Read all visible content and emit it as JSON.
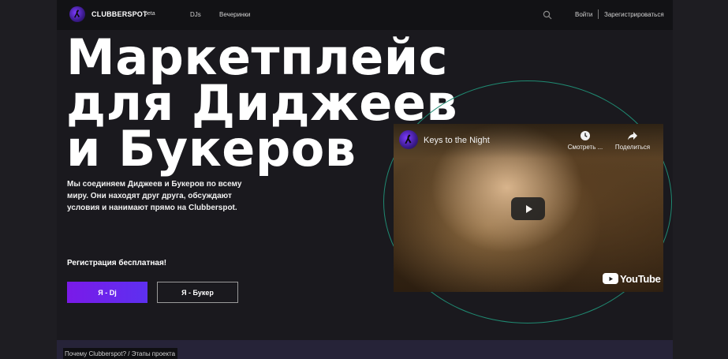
{
  "brand": {
    "name": "CLUBBERSPOT",
    "tag": "beta",
    "logo_icon": "dj-silhouette-icon",
    "logo_color": "#5d2ccf"
  },
  "nav": {
    "djs": "DJs",
    "parties": "Вечеринки",
    "search_icon": "search-icon",
    "login": "Войти",
    "register": "Зарегистрироваться"
  },
  "hero": {
    "title_lines": [
      "Маркетплейс",
      "для Диджеев",
      "и Букеров"
    ],
    "description": "Мы соединяем Диджеев и Букеров по всему миру. Они находят друг друга, обсуждают условия и нанимают прямо на Clubberspot.",
    "free_note": "Регистрация бесплатная!",
    "btn_dj": "Я - Dj",
    "btn_booker": "Я - Букер",
    "accent": "#7a1ae8",
    "ring_color": "#1f8a72"
  },
  "video": {
    "title": "Keys to the Night",
    "watch_later": "Смотреть ...",
    "share": "Поделиться",
    "provider": "YouTube",
    "play_icon": "play-icon"
  },
  "bottom": {
    "tab_label": "Почему Clubberspot? / Этапы проекта"
  }
}
